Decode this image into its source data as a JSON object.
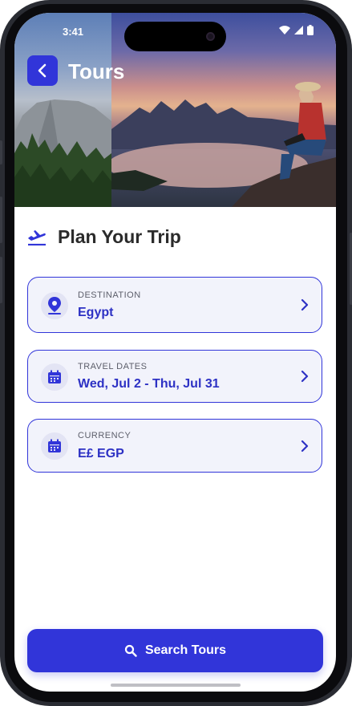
{
  "status": {
    "time": "3:41"
  },
  "header": {
    "title": "Tours"
  },
  "section": {
    "title": "Plan Your Trip"
  },
  "fields": [
    {
      "label": "DESTINATION",
      "value": "Egypt",
      "icon": "location-pin-icon"
    },
    {
      "label": "TRAVEL DATES",
      "value": "Wed, Jul 2 - Thu, Jul 31",
      "icon": "calendar-icon"
    },
    {
      "label": "CURRENCY",
      "value": "E£ EGP",
      "icon": "calendar-icon"
    }
  ],
  "actions": {
    "search_label": "Search Tours"
  },
  "colors": {
    "accent": "#3135d9",
    "card_bg": "#f2f3fb",
    "value_text": "#2d31c4"
  }
}
